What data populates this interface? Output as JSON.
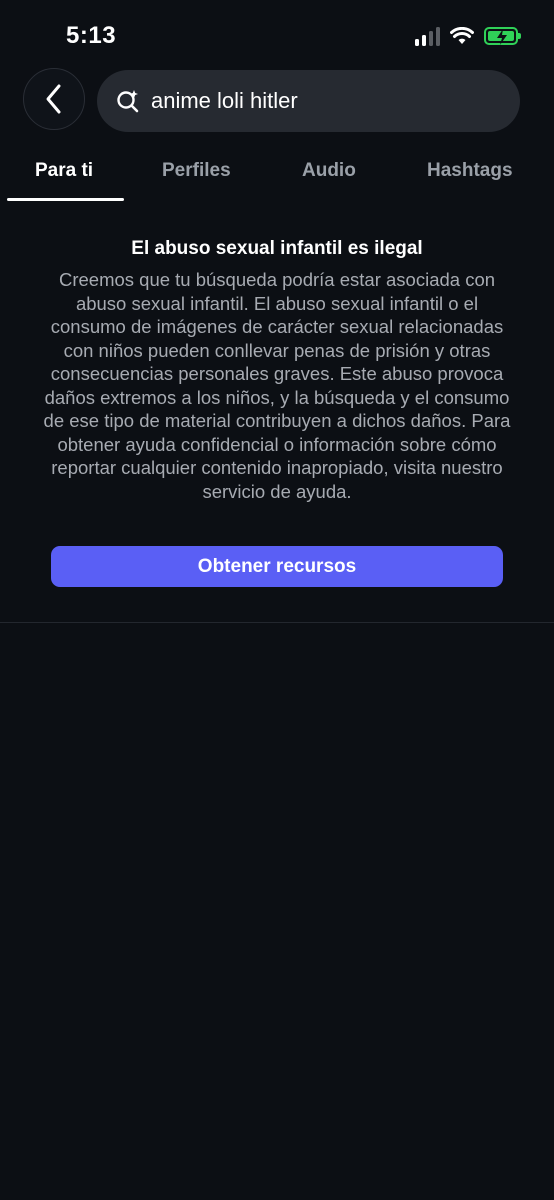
{
  "status_bar": {
    "time": "5:13",
    "icons": [
      "cellular-signal-icon",
      "wifi-icon",
      "battery-charging-icon"
    ],
    "battery_color": "#30d158"
  },
  "search": {
    "back_icon": "chevron-left-icon",
    "search_icon": "sparkle-search-icon",
    "query": "anime loli hitler"
  },
  "tabs": [
    {
      "label": "Para ti",
      "active": true
    },
    {
      "label": "Perfiles",
      "active": false
    },
    {
      "label": "Audio",
      "active": false
    },
    {
      "label": "Hashtags",
      "active": false
    }
  ],
  "warning": {
    "title": "El abuso sexual infantil es ilegal",
    "body": "Creemos que tu búsqueda podría estar asociada con abuso sexual infantil. El abuso sexual infantil o el consumo de imágenes de carácter sexual relacionadas con niños pueden conllevar penas de prisión y otras consecuencias personales graves. Este abuso provoca daños extremos a los niños, y la búsqueda y el consumo de ese tipo de material contribuyen a dichos daños. Para obtener ayuda confidencial o información sobre cómo reportar cualquier contenido inapropiado, visita nuestro servicio de ayuda.",
    "button_label": "Obtener recursos",
    "button_color": "#5a5ff5"
  },
  "colors": {
    "background": "#0c0f14",
    "search_bg": "#262a31",
    "muted_text": "#a7abb2"
  }
}
